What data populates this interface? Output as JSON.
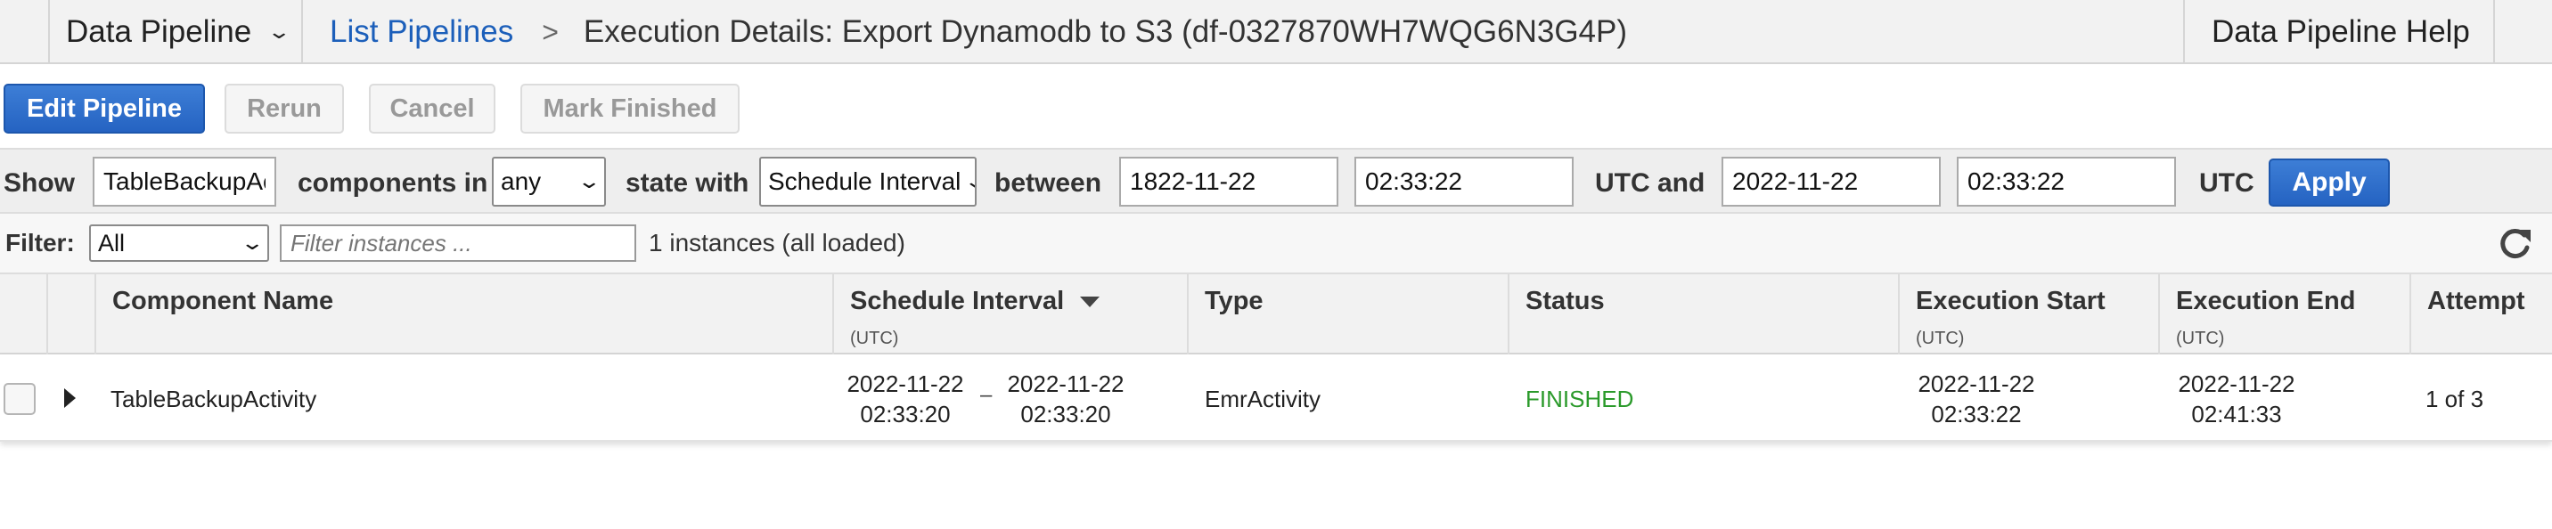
{
  "topbar": {
    "service_menu": "Data Pipeline",
    "breadcrumb_link": "List Pipelines",
    "breadcrumb_current": "Execution Details: Export Dynamodb to S3 (df-0327870WH7WQG6N3G4P)",
    "help": "Data Pipeline Help"
  },
  "actions": {
    "edit": "Edit Pipeline",
    "rerun": "Rerun",
    "cancel": "Cancel",
    "mark_finished": "Mark Finished"
  },
  "filter_row": {
    "show_label": "Show",
    "component_value": "TableBackupActivity",
    "components_in_label": "components in",
    "state_value": "any",
    "state_with_label": "state with",
    "interval_value": "Schedule Interval",
    "between_label": "between",
    "start_date": "1822-11-22",
    "start_time": "02:33:22",
    "utc_and_label": "UTC and",
    "end_date": "2022-11-22",
    "end_time": "02:33:22",
    "utc_label": "UTC",
    "apply": "Apply"
  },
  "filter_row2": {
    "filter_label": "Filter:",
    "filter_value": "All",
    "filter_placeholder": "Filter instances ...",
    "count_text": "1 instances (all loaded)"
  },
  "table": {
    "columns": {
      "component_name": "Component Name",
      "schedule_interval": "Schedule Interval",
      "schedule_interval_sub": "(UTC)",
      "type": "Type",
      "status": "Status",
      "execution_start": "Execution Start",
      "execution_start_sub": "(UTC)",
      "execution_end": "Execution End",
      "execution_end_sub": "(UTC)",
      "attempt": "Attempt"
    },
    "rows": [
      {
        "component_name": "TableBackupActivity",
        "interval_start_date": "2022-11-22",
        "interval_start_time": "02:33:20",
        "interval_sep": "–",
        "interval_end_date": "2022-11-22",
        "interval_end_time": "02:33:20",
        "type": "EmrActivity",
        "status": "FINISHED",
        "execution_start_date": "2022-11-22",
        "execution_start_time": "02:33:22",
        "execution_end_date": "2022-11-22",
        "execution_end_time": "02:41:33",
        "attempt": "1 of 3"
      }
    ]
  },
  "colors": {
    "primary": "#2a6bc8",
    "link": "#1c5fba",
    "status_finished": "#2b9a2b"
  }
}
